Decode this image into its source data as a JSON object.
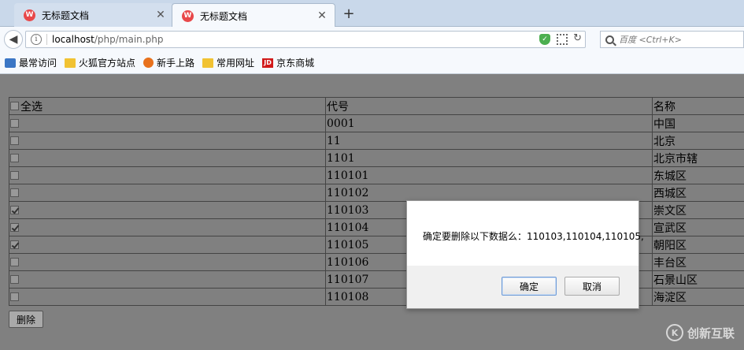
{
  "browser": {
    "tabs": [
      {
        "title": "无标题文档",
        "active": false
      },
      {
        "title": "无标题文档",
        "active": true
      }
    ],
    "tab_icon_glyph": "W",
    "new_tab_label": "+",
    "url_host": "localhost",
    "url_path": "/php/main.php",
    "search_placeholder": "百度 <Ctrl+K>",
    "bookmarks": [
      {
        "label": "最常访问",
        "icon": "star-icon"
      },
      {
        "label": "火狐官方站点",
        "icon": "folder-icon"
      },
      {
        "label": "新手上路",
        "icon": "firefox-icon"
      },
      {
        "label": "常用网址",
        "icon": "folder-icon"
      },
      {
        "label": "京东商城",
        "icon": "jd-icon"
      }
    ],
    "jd_glyph": "JD"
  },
  "table": {
    "headers": {
      "select_all": "全选",
      "code": "代号",
      "name": "名称"
    },
    "rows": [
      {
        "checked": false,
        "code": "0001",
        "name": "中国"
      },
      {
        "checked": false,
        "code": "11",
        "name": "北京"
      },
      {
        "checked": false,
        "code": "1101",
        "name": "北京市辖"
      },
      {
        "checked": false,
        "code": "110101",
        "name": "东城区"
      },
      {
        "checked": false,
        "code": "110102",
        "name": "西城区"
      },
      {
        "checked": true,
        "code": "110103",
        "name": "崇文区"
      },
      {
        "checked": true,
        "code": "110104",
        "name": "宣武区"
      },
      {
        "checked": true,
        "code": "110105",
        "name": "朝阳区"
      },
      {
        "checked": false,
        "code": "110106",
        "name": "丰台区"
      },
      {
        "checked": false,
        "code": "110107",
        "name": "石景山区"
      },
      {
        "checked": false,
        "code": "110108",
        "name": "海淀区"
      }
    ]
  },
  "delete_button": "删除",
  "dialog": {
    "message": "确定要删除以下数据么：110103,110104,110105,",
    "ok_label": "确定",
    "cancel_label": "取消"
  },
  "watermark": {
    "text": "创新互联",
    "glyph": "K"
  }
}
